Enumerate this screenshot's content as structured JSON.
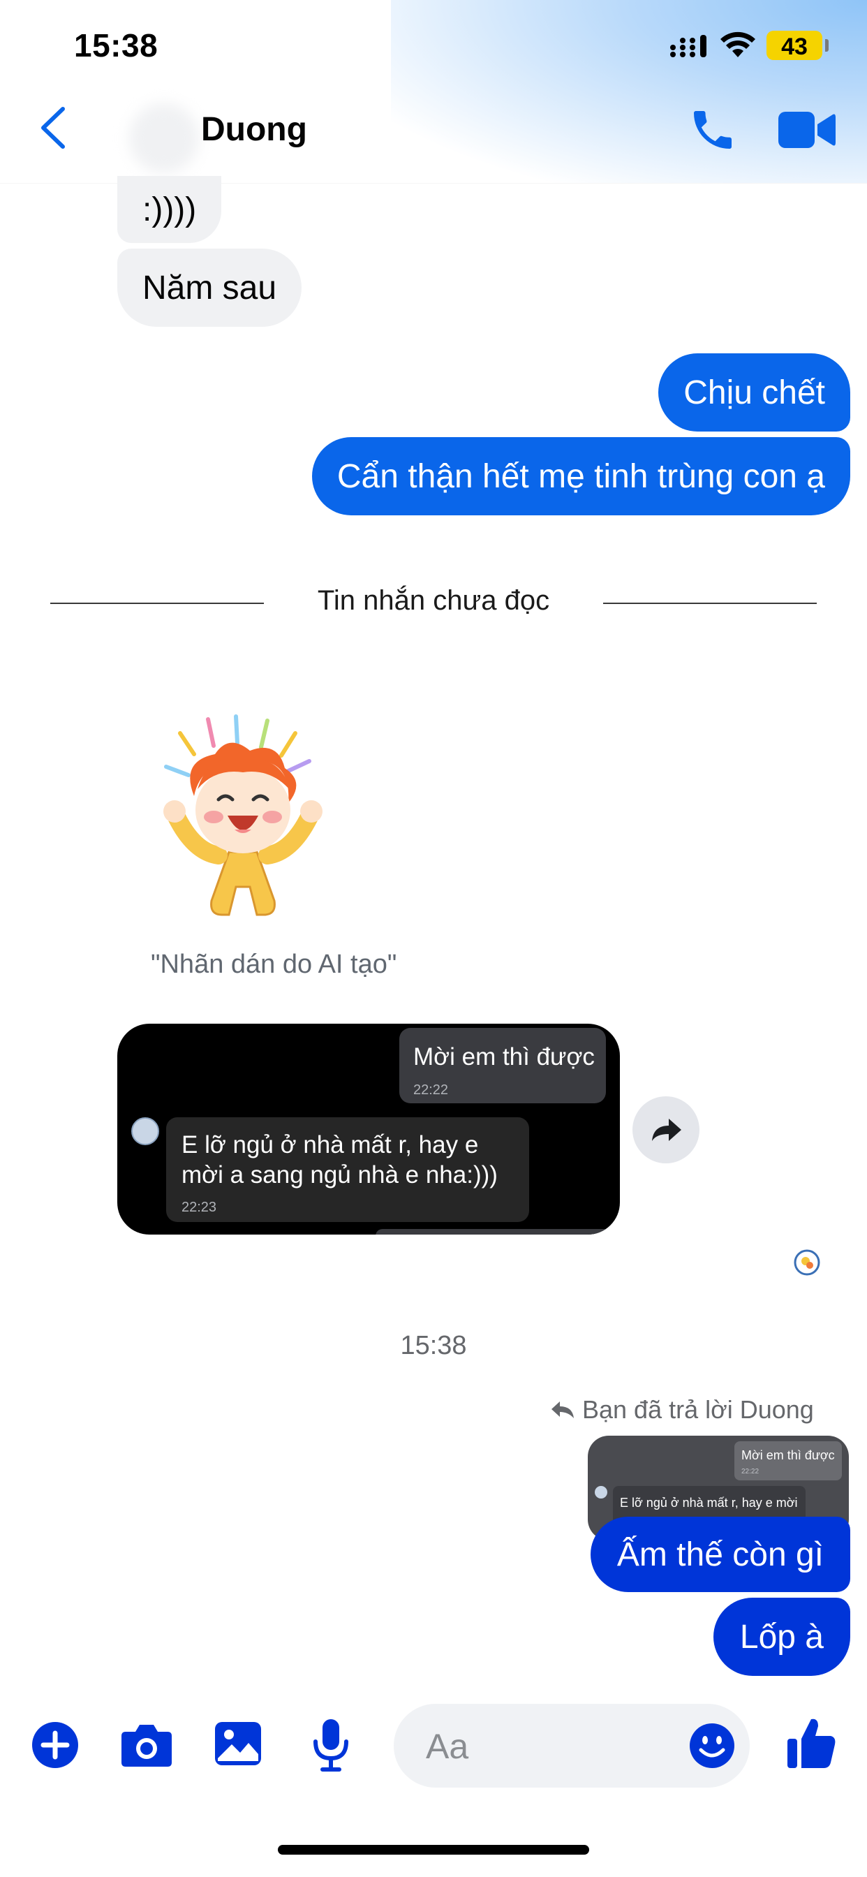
{
  "status_bar": {
    "time": "15:38",
    "battery": "43"
  },
  "header": {
    "contact_name": "Duong"
  },
  "messages": {
    "in_1": ":))))",
    "in_2": "Năm sau",
    "out_1": "Chịu chết",
    "out_2": "Cẩn thận hết mẹ tinh trùng con ạ",
    "unread_divider": "Tin nhắn chưa đọc",
    "sticker_caption": "\"Nhãn dán do AI tạo\"",
    "forwarded": {
      "out_text": "Mời em thì được",
      "out_time": "22:22",
      "in_text": "E lỡ ngủ ở nhà mất r, hay e mời a sang ngủ nhà e nha:)))",
      "in_time": "22:23"
    },
    "timestamp": "15:38",
    "replied_label": "Bạn đã trả lời Duong",
    "reply_preview": {
      "out_text": "Mời em thì được",
      "out_time": "22:22",
      "in_text": "E lỡ ngủ ở nhà mất r, hay e mời"
    },
    "out_3": "Ấm thế còn gì",
    "out_4": "Lốp à"
  },
  "composer": {
    "placeholder": "Aa"
  },
  "colors": {
    "accent": "#0a66ea",
    "accent_dark": "#0035d8",
    "incoming_bg": "#f0f1f3"
  },
  "icons": [
    "back-chevron-icon",
    "phone-icon",
    "video-camera-icon",
    "plus-icon",
    "camera-icon",
    "gallery-icon",
    "microphone-icon",
    "emoji-icon",
    "thumbs-up-icon",
    "forward-arrow-icon",
    "reply-arrow-icon"
  ]
}
